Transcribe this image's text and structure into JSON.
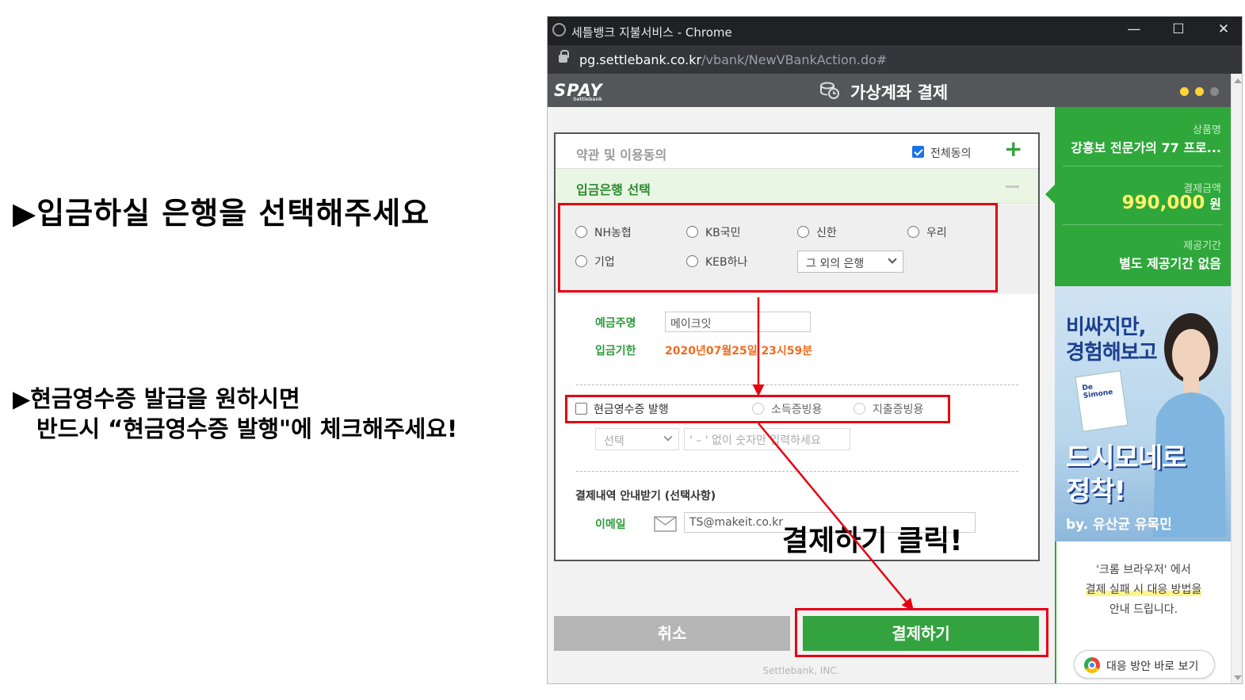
{
  "instructions": {
    "line1": "▶입금하실 은행을 선택해주세요",
    "line2a": "▶현금영수증 발급을 원하시면",
    "line2b": "반드시 “현금영수증 발행\"에 체크해주세요!",
    "click_hint": "결제하기 클릭!"
  },
  "window": {
    "title": "세틀뱅크 지불서비스 - Chrome",
    "url_host": "pg.settlebank.co.kr",
    "url_path": "/vbank/NewVBankAction.do#",
    "minimize": "—",
    "maximize": "☐",
    "close": "✕"
  },
  "header": {
    "logo": "SPAY",
    "logo_sub": "Settlebank",
    "title": "가상계좌 결제"
  },
  "terms": {
    "label": "약관 및 이용동의",
    "agree_all": "전체동의",
    "agree_all_checked": true,
    "expand": "+"
  },
  "bank": {
    "label": "입금은행 선택",
    "options": [
      "NH농협",
      "KB국민",
      "신한",
      "우리",
      "기업",
      "KEB하나"
    ],
    "other_select": "그 외의 은행"
  },
  "account": {
    "holder_label": "예금주명",
    "holder_value": "메이크잇",
    "deadline_label": "입금기한",
    "deadline_value": "2020년07월25일 23시59분"
  },
  "receipt": {
    "issue_label": "현금영수증 발행",
    "income_label": "소득증빙용",
    "expense_label": "지출증빙용",
    "type_select": "선택",
    "number_placeholder": "' – ' 없이 숫자만 입력하세요"
  },
  "notify": {
    "label": "결제내역 안내받기 (선택사항)",
    "email_label": "이메일",
    "email_value": "TS@makeit.co.kr"
  },
  "buttons": {
    "cancel": "취소",
    "pay": "결제하기"
  },
  "footer": "Settlebank, INC.",
  "panel": {
    "product_label": "상품명",
    "product_value": "강흥보 전문가의 77 프로...",
    "amount_label": "결제금액",
    "amount_value": "990,000",
    "amount_unit": "원",
    "period_label": "제공기간",
    "period_value": "별도 제공기간 없음"
  },
  "ad": {
    "line1": "비싸지만,",
    "line2": "경험해보고",
    "line3": "드시모네로",
    "line4": "정착!",
    "line5": "by. 유산균 유목민",
    "box": "De Simone"
  },
  "help": {
    "line1": "'크롬 브라우저' 에서",
    "line2": "결제 실패 시 대응 방법을",
    "line3": "안내 드립니다.",
    "button": "대응 방안 바로 보기"
  },
  "colors": {
    "accent_green": "#2fa73b",
    "annotation_red": "#e60012",
    "header_gray": "#555659"
  }
}
